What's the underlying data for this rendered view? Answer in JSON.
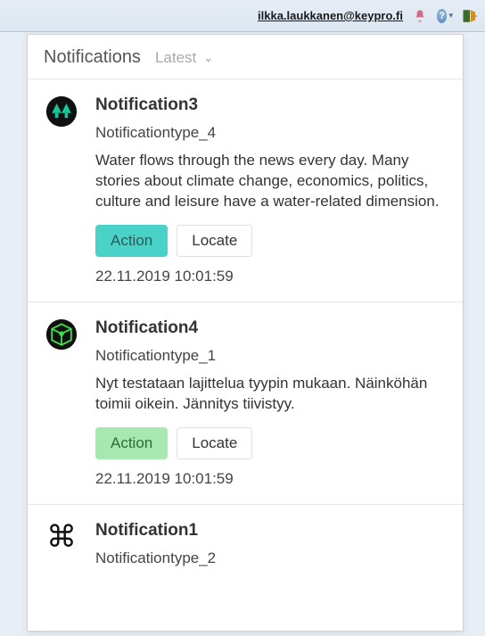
{
  "topbar": {
    "user_email": "ilkka.laukkanen@keypro.fi",
    "bell_icon": "bell-icon",
    "help_icon": "help-icon",
    "exit_icon": "exit-icon"
  },
  "panel": {
    "title": "Notifications",
    "sort_label": "Latest"
  },
  "buttons": {
    "action": "Action",
    "locate": "Locate"
  },
  "notifications": [
    {
      "icon": "trees-icon",
      "title": "Notification3",
      "type": "Notificationtype_4",
      "description": "Water flows through the news every day. Many stories about climate change, economics, politics, culture and leisure have a water-related dimension.",
      "action_variant": "teal",
      "timestamp": "22.11.2019 10:01:59"
    },
    {
      "icon": "cube-icon",
      "title": "Notification4",
      "type": "Notificationtype_1",
      "description": "Nyt testataan lajittelua tyypin mukaan. Näinköhän toimii oikein. Jännitys tiivistyy.",
      "action_variant": "green",
      "timestamp": "22.11.2019 10:01:59"
    },
    {
      "icon": "command-icon",
      "title": "Notification1",
      "type": "Notificationtype_2",
      "description": "",
      "action_variant": "",
      "timestamp": ""
    }
  ]
}
